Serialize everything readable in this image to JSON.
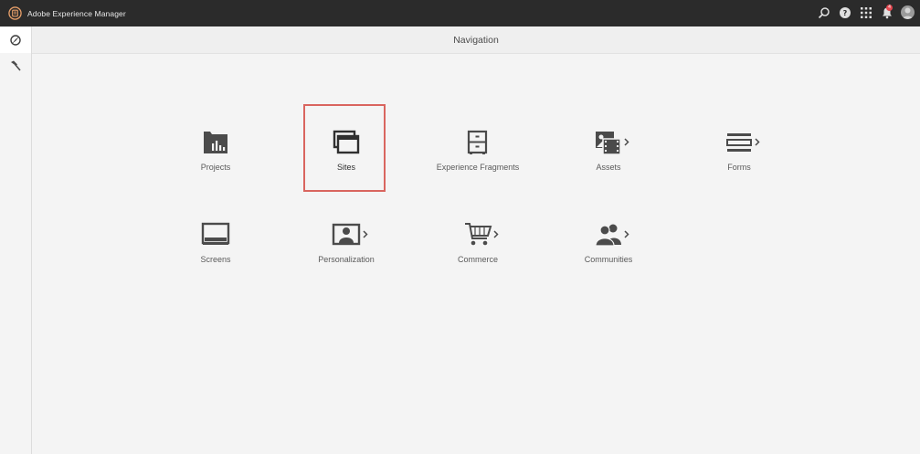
{
  "app": {
    "title": "Adobe Experience Manager",
    "notification_count": "4"
  },
  "header": {
    "title": "Navigation"
  },
  "topbar_icons": [
    "search-icon",
    "help-icon",
    "apps-grid-icon",
    "bell-icon",
    "avatar"
  ],
  "rail": {
    "items": [
      "navigation-icon",
      "tools-icon"
    ]
  },
  "tiles": [
    {
      "label": "Projects",
      "icon": "projects-icon",
      "has_chevron": false
    },
    {
      "label": "Sites",
      "icon": "sites-icon",
      "has_chevron": false,
      "selected": true
    },
    {
      "label": "Experience Fragments",
      "icon": "experience-fragments-icon",
      "has_chevron": false
    },
    {
      "label": "Assets",
      "icon": "assets-icon",
      "has_chevron": true
    },
    {
      "label": "Forms",
      "icon": "forms-icon",
      "has_chevron": true
    },
    {
      "label": "Screens",
      "icon": "screens-icon",
      "has_chevron": false
    },
    {
      "label": "Personalization",
      "icon": "personalization-icon",
      "has_chevron": true
    },
    {
      "label": "Commerce",
      "icon": "commerce-icon",
      "has_chevron": true
    },
    {
      "label": "Communities",
      "icon": "communities-icon",
      "has_chevron": true
    }
  ],
  "colors": {
    "topbar": "#2b2b2b",
    "icon": "#4b4b4b",
    "highlight": "#d9655f",
    "badge": "#e34850"
  }
}
